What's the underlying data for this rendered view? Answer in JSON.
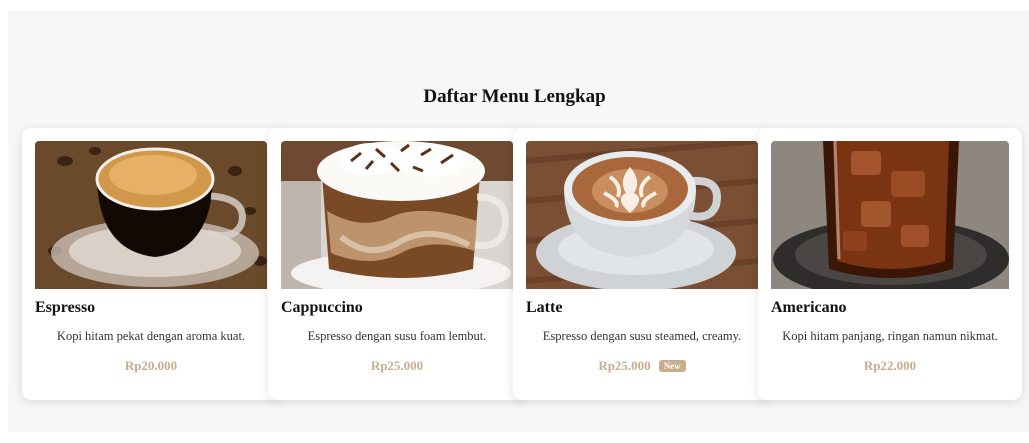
{
  "page": {
    "title": "Daftar Menu Lengkap"
  },
  "menu_items": [
    {
      "name": "Espresso",
      "description": "Kopi hitam pekat dengan aroma kuat.",
      "price": "Rp20.000",
      "image_icon": "espresso-cup-photo"
    },
    {
      "name": "Cappuccino",
      "description": "Espresso dengan susu foam lembut.",
      "price": "Rp25.000",
      "image_icon": "cappuccino-glass-photo"
    },
    {
      "name": "Latte",
      "description": "Espresso dengan susu steamed, creamy.",
      "price": "Rp25.000",
      "badge": "New",
      "image_icon": "latte-art-cup-photo"
    },
    {
      "name": "Americano",
      "description": "Kopi hitam panjang, ringan namun nikmat.",
      "price": "Rp22.000",
      "image_icon": "iced-americano-glass-photo"
    }
  ],
  "colors": {
    "price": "#c8ad8c",
    "badge": "#c8ad8c",
    "background": "#f7f7f7"
  }
}
